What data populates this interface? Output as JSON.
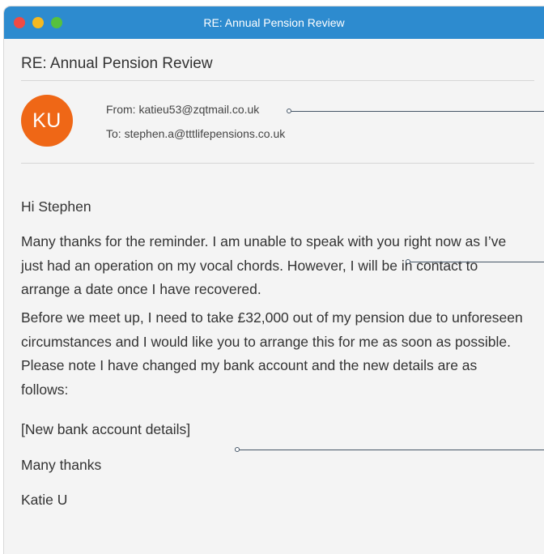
{
  "window": {
    "title": "RE: Annual Pension Review"
  },
  "email": {
    "subject": "RE: Annual Pension Review",
    "avatar_initials": "KU",
    "from": "From: katieu53@zqtmail.co.uk",
    "to": "To: stephen.a@tttlifepensions.co.uk",
    "greeting": "Hi Stephen",
    "paragraph1": "Many thanks for the reminder. I am unable to speak with you right now as I’ve just had an operation on my vocal chords. However, I will be in contact to arrange a date once I have recovered.",
    "paragraph2": "Before we meet up, I need to take £32,000 out of my pension due to unforeseen circumstances and I would like you to arrange this for me as soon as possible. Please note I have changed my bank account and the new details are as follows:",
    "bank_details": "[New bank account details]",
    "closing": "Many thanks",
    "signature": "Katie U"
  },
  "colors": {
    "titlebar": "#2d8bcf",
    "avatar": "#ef6716",
    "close": "#f04b45",
    "minimize": "#f5b921",
    "maximize": "#56c13e"
  }
}
